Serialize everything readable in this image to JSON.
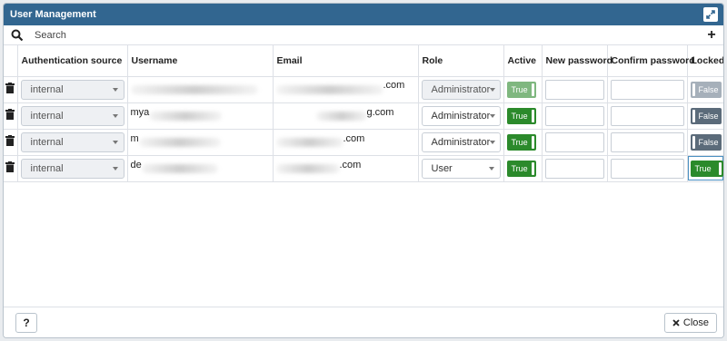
{
  "dialog": {
    "title": "User Management"
  },
  "search": {
    "placeholder": "Search"
  },
  "columns": {
    "auth_source": "Authentication source",
    "username": "Username",
    "email": "Email",
    "role": "Role",
    "active": "Active",
    "new_password": "New password",
    "confirm_password": "Confirm password",
    "locked": "Locked"
  },
  "rows": [
    {
      "auth_source": "internal",
      "username": "",
      "email_suffix": ".com",
      "role": "Administrator",
      "active": "True",
      "locked": "False"
    },
    {
      "auth_source": "internal",
      "username": "mya",
      "email_suffix": "g.com",
      "role": "Administrator",
      "active": "True",
      "locked": "False"
    },
    {
      "auth_source": "internal",
      "username": "m",
      "email_suffix": ".com",
      "role": "Administrator",
      "active": "True",
      "locked": "False"
    },
    {
      "auth_source": "internal",
      "username": "de",
      "email_suffix": ".com",
      "role": "User",
      "active": "True",
      "locked": "True"
    }
  ],
  "footer": {
    "help_label": "?",
    "close_label": "Close"
  },
  "colors": {
    "titlebar": "#326690",
    "toggle_on": "#2b8a2b",
    "toggle_off": "#5b6b7a"
  }
}
